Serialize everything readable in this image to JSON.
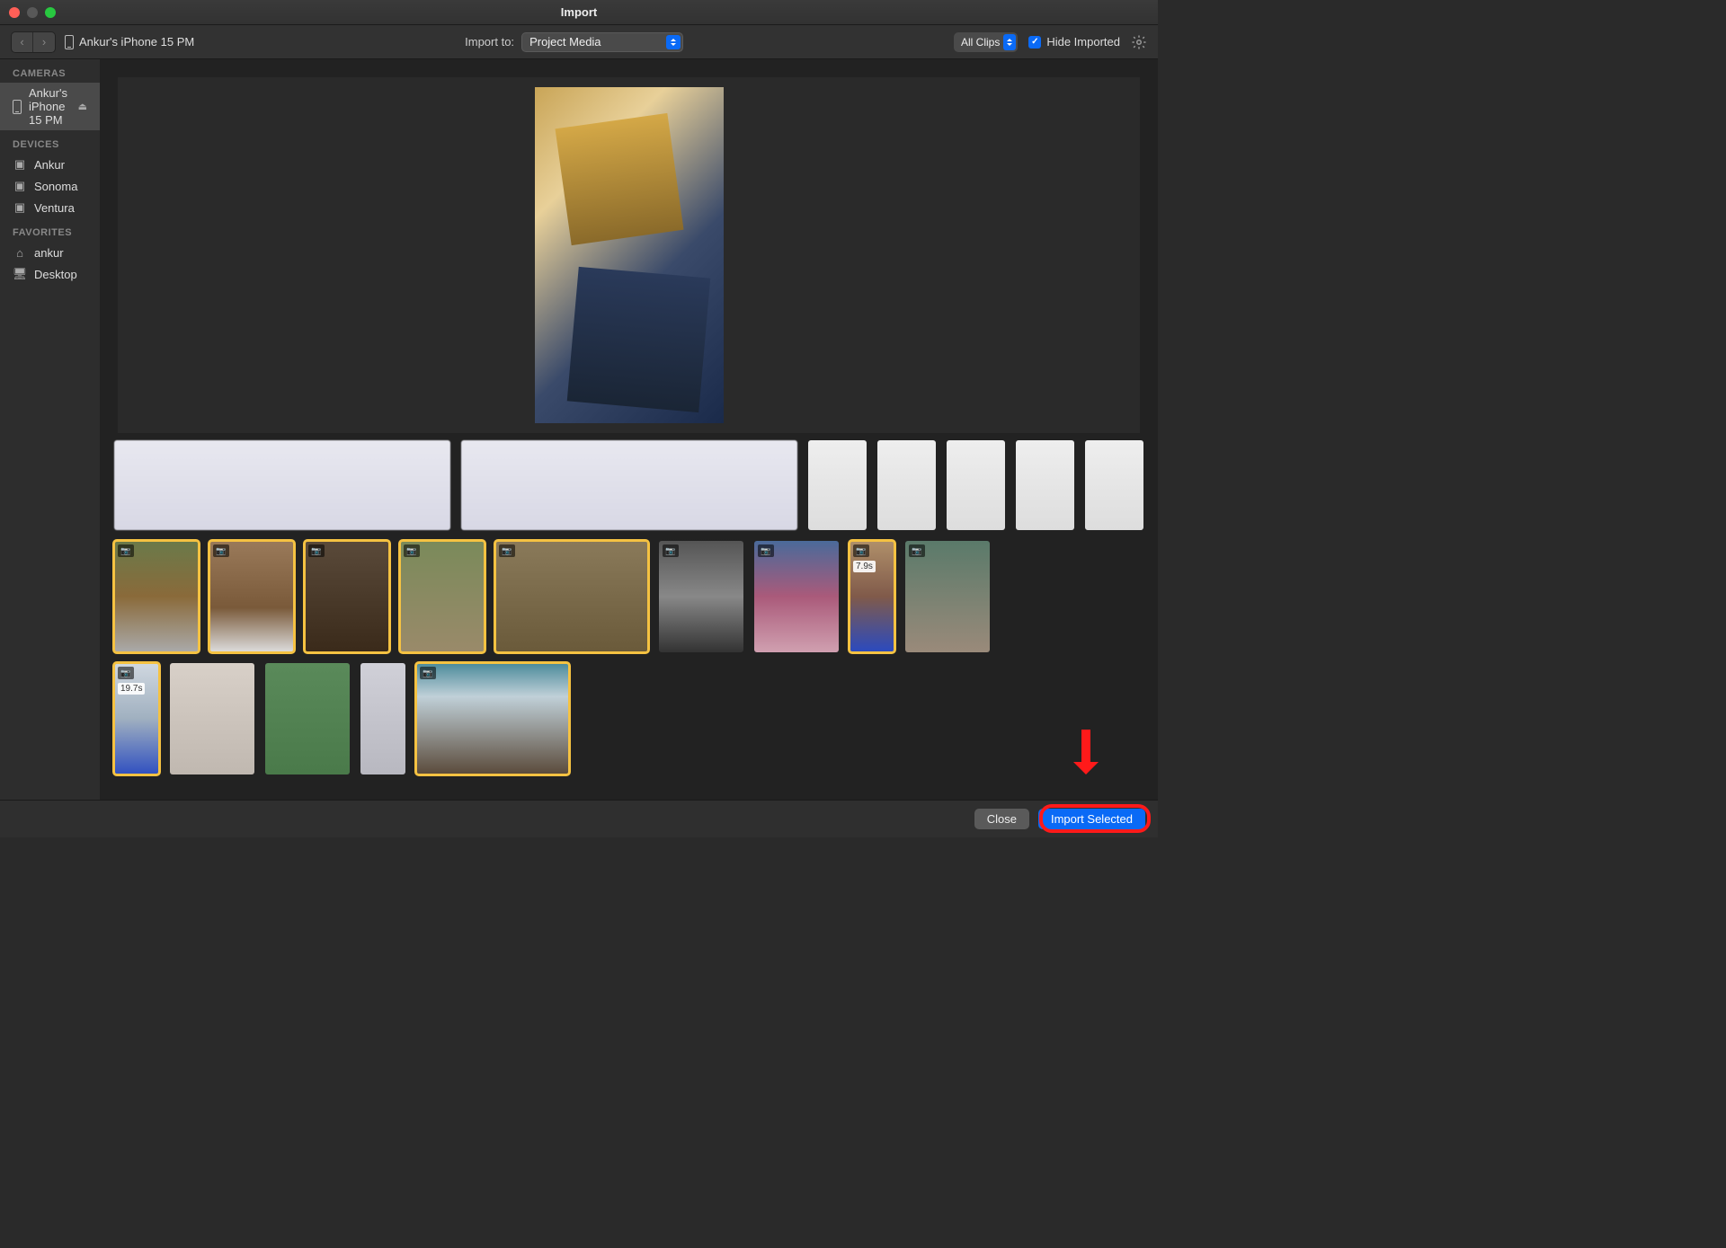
{
  "window": {
    "title": "Import"
  },
  "toolbar": {
    "device": "Ankur's iPhone 15 PM",
    "import_to_label": "Import to:",
    "import_to_value": "Project Media",
    "clips_filter": "All Clips",
    "hide_imported_label": "Hide Imported",
    "hide_imported_checked": true
  },
  "sidebar": {
    "sections": [
      {
        "header": "CAMERAS",
        "items": [
          {
            "icon": "phone",
            "label": "Ankur's iPhone 15 PM",
            "active": true,
            "eject": true
          }
        ]
      },
      {
        "header": "DEVICES",
        "items": [
          {
            "icon": "drive",
            "label": "Ankur"
          },
          {
            "icon": "drive",
            "label": "Sonoma"
          },
          {
            "icon": "drive",
            "label": "Ventura"
          }
        ]
      },
      {
        "header": "FAVORITES",
        "items": [
          {
            "icon": "home",
            "label": "ankur"
          },
          {
            "icon": "desktop",
            "label": "Desktop"
          }
        ]
      }
    ]
  },
  "thumbnails": {
    "row1": [
      {
        "type": "blur-wide"
      },
      {
        "type": "blur-wide"
      },
      {
        "type": "blur-sm"
      },
      {
        "type": "blur-sm"
      },
      {
        "type": "blur-sm"
      },
      {
        "type": "blur-sm"
      },
      {
        "type": "ocean"
      }
    ],
    "row2": [
      {
        "type": "photo",
        "cls": "p1",
        "selected": true,
        "badge": true
      },
      {
        "type": "photo",
        "cls": "p2",
        "selected": true,
        "badge": true
      },
      {
        "type": "photo",
        "cls": "p3",
        "selected": true,
        "badge": true
      },
      {
        "type": "photo",
        "cls": "p4",
        "selected": true,
        "badge": true
      },
      {
        "type": "photo-wide",
        "cls": "p5",
        "selected": true,
        "badge": true
      },
      {
        "type": "photo",
        "cls": "p6",
        "selected": false,
        "badge": true
      },
      {
        "type": "photo",
        "cls": "p7",
        "selected": false,
        "badge": true
      },
      {
        "type": "vid",
        "cls": "p8",
        "selected": true,
        "badge": true,
        "dur": "7.9s"
      },
      {
        "type": "photo",
        "cls": "p9",
        "selected": false,
        "badge": true
      }
    ],
    "row3": [
      {
        "type": "vid",
        "cls": "p10",
        "selected": true,
        "badge": true,
        "dur": "19.7s"
      },
      {
        "type": "photo",
        "cls": "p11",
        "selected": false
      },
      {
        "type": "photo",
        "cls": "p13",
        "selected": false
      },
      {
        "type": "vid",
        "cls": "p14",
        "selected": false,
        "wide50": true
      },
      {
        "type": "photo-wide",
        "cls": "p15",
        "selected": true,
        "badge": true
      }
    ]
  },
  "footer": {
    "close": "Close",
    "import_selected": "Import Selected"
  }
}
